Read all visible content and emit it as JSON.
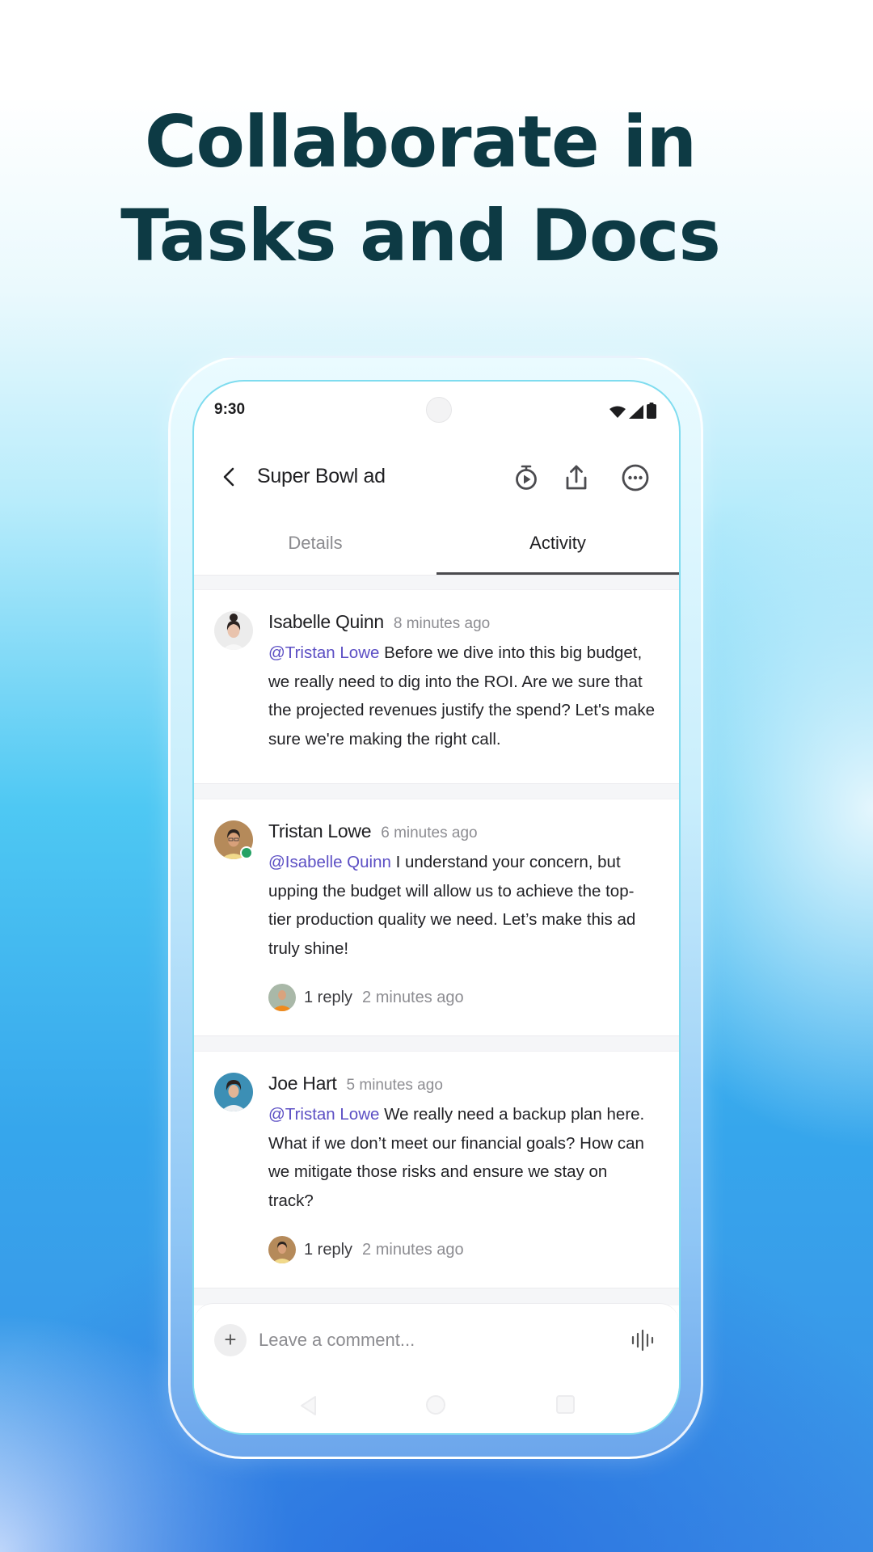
{
  "headline": {
    "line1": "Collaborate in",
    "line2": "Tasks and Docs"
  },
  "status_bar": {
    "time": "9:30",
    "icons": [
      "wifi-icon",
      "signal-icon",
      "battery-icon"
    ]
  },
  "header": {
    "title": "Super Bowl ad",
    "back_icon": "chevron-left-icon",
    "actions": [
      "timer-play-icon",
      "share-icon",
      "more-horizontal-icon"
    ]
  },
  "tabs": [
    {
      "label": "Details",
      "active": false
    },
    {
      "label": "Activity",
      "active": true
    }
  ],
  "comments": [
    {
      "author": "Isabelle Quinn",
      "time": "8 minutes ago",
      "online": false,
      "mention": "@Tristan Lowe",
      "text": "Before we dive into this big budget, we really need to dig into the ROI. Are we sure that the projected revenues justify the spend? Let's make sure we're making the right call."
    },
    {
      "author": "Tristan Lowe",
      "time": "6 minutes ago",
      "online": true,
      "mention": "@Isabelle Quinn",
      "text": "I understand your concern, but upping the budget will allow us to achieve the top-tier production quality we need. Let’s make this ad truly shine!",
      "replies": {
        "count": "1 reply",
        "time": "2 minutes ago"
      }
    },
    {
      "author": "Joe Hart",
      "time": "5 minutes ago",
      "online": false,
      "mention": "@Tristan Lowe",
      "text": "We really need a backup plan here. What if we don’t meet our financial goals? How can we mitigate those risks and ensure we stay on track?",
      "replies": {
        "count": "1 reply",
        "time": "2 minutes ago"
      }
    }
  ],
  "composer": {
    "placeholder": "Leave a comment...",
    "value": "",
    "add_icon": "plus-icon",
    "voice_icon": "voice-waveform-icon"
  },
  "colors": {
    "mention": "#5c4fc4",
    "online": "#25a265",
    "headline": "#0d3a44"
  }
}
